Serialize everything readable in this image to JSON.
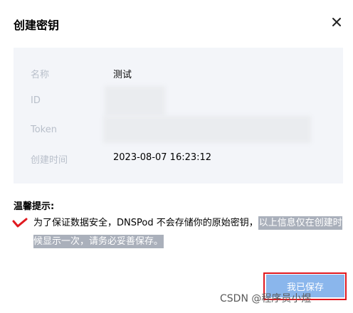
{
  "dialog": {
    "title": "创建密钥",
    "close_icon": "close-icon"
  },
  "info": {
    "rows": [
      {
        "label": "名称",
        "value": "测试"
      },
      {
        "label": "ID",
        "value": ""
      },
      {
        "label": "Token",
        "value": ""
      },
      {
        "label": "创建时间",
        "value": "2023-08-07 16:23:12"
      }
    ]
  },
  "tip": {
    "title": "温馨提示:",
    "text_plain": "为了保证数据安全，DNSPod 不会存储你的原始密钥，",
    "text_highlight": "以上信息仅在创建时候显示一次，请务必妥善保存。"
  },
  "actions": {
    "save_label": "我已保存"
  },
  "watermark": {
    "text": "CSDN @程序员小煜"
  },
  "colors": {
    "primary_button": "#8ab6ec",
    "info_background": "#f3f5f9",
    "label_gray": "#b8bfca",
    "highlight": "#aab0bb",
    "annotation_red": "#e0191f"
  }
}
